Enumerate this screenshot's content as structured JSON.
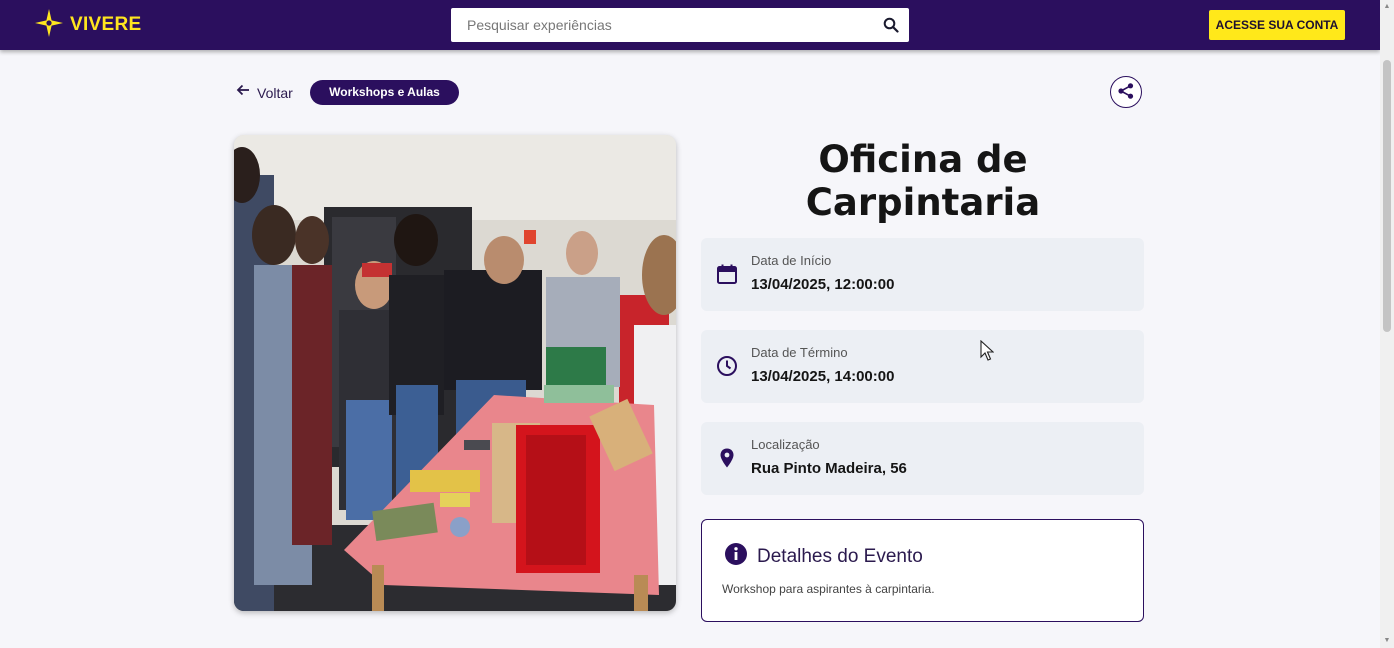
{
  "header": {
    "logo_text": "VIVERE",
    "search_placeholder": "Pesquisar experiências",
    "account_button": "ACESSE SUA CONTA"
  },
  "nav": {
    "back_label": "Voltar",
    "category": "Workshops e Aulas"
  },
  "event": {
    "title": "Oficina de Carpintaria",
    "start": {
      "label": "Data de Início",
      "value": "13/04/2025, 12:00:00",
      "icon": "calendar-icon"
    },
    "end": {
      "label": "Data de Término",
      "value": "13/04/2025, 14:00:00",
      "icon": "clock-icon"
    },
    "location": {
      "label": "Localização",
      "value": "Rua Pinto Madeira, 56",
      "icon": "location-pin-icon"
    },
    "details": {
      "title": "Detalhes do Evento",
      "description": "Workshop para aspirantes à carpintaria.",
      "icon": "info-icon"
    }
  },
  "colors": {
    "brand_purple": "#2b0f5e",
    "brand_yellow": "#ffe81a",
    "card_bg": "#eceff4"
  }
}
